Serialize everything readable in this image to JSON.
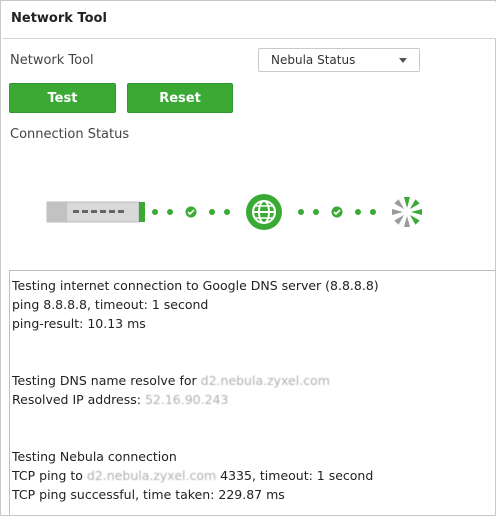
{
  "panel": {
    "title": "Network Tool"
  },
  "form": {
    "field_label": "Network Tool",
    "selected_tool": "Nebula Status",
    "test_label": "Test",
    "reset_label": "Reset"
  },
  "connection": {
    "label": "Connection Status",
    "icons": [
      "switch-device-icon",
      "globe-icon",
      "nebula-cloud-icon"
    ],
    "status_color": "#3aaa35"
  },
  "output": {
    "block1": [
      "Testing internet connection to Google DNS server (8.8.8.8)",
      "ping 8.8.8.8, timeout: 1 second",
      "ping-result: 10.13 ms"
    ],
    "block2": {
      "resolve_prefix": "Testing DNS name resolve for ",
      "resolve_host": "d2.nebula.zyxel.com",
      "resolved_prefix": "Resolved IP address: ",
      "resolved_ip": "52.16.90.243"
    },
    "block3": {
      "heading": "Testing Nebula connection",
      "tcp_prefix": "TCP ping to ",
      "tcp_host": "d2.nebula.zyxel.com",
      "tcp_suffix": " 4335, timeout: 1 second",
      "result": "TCP ping successful, time taken: 229.87 ms"
    }
  }
}
